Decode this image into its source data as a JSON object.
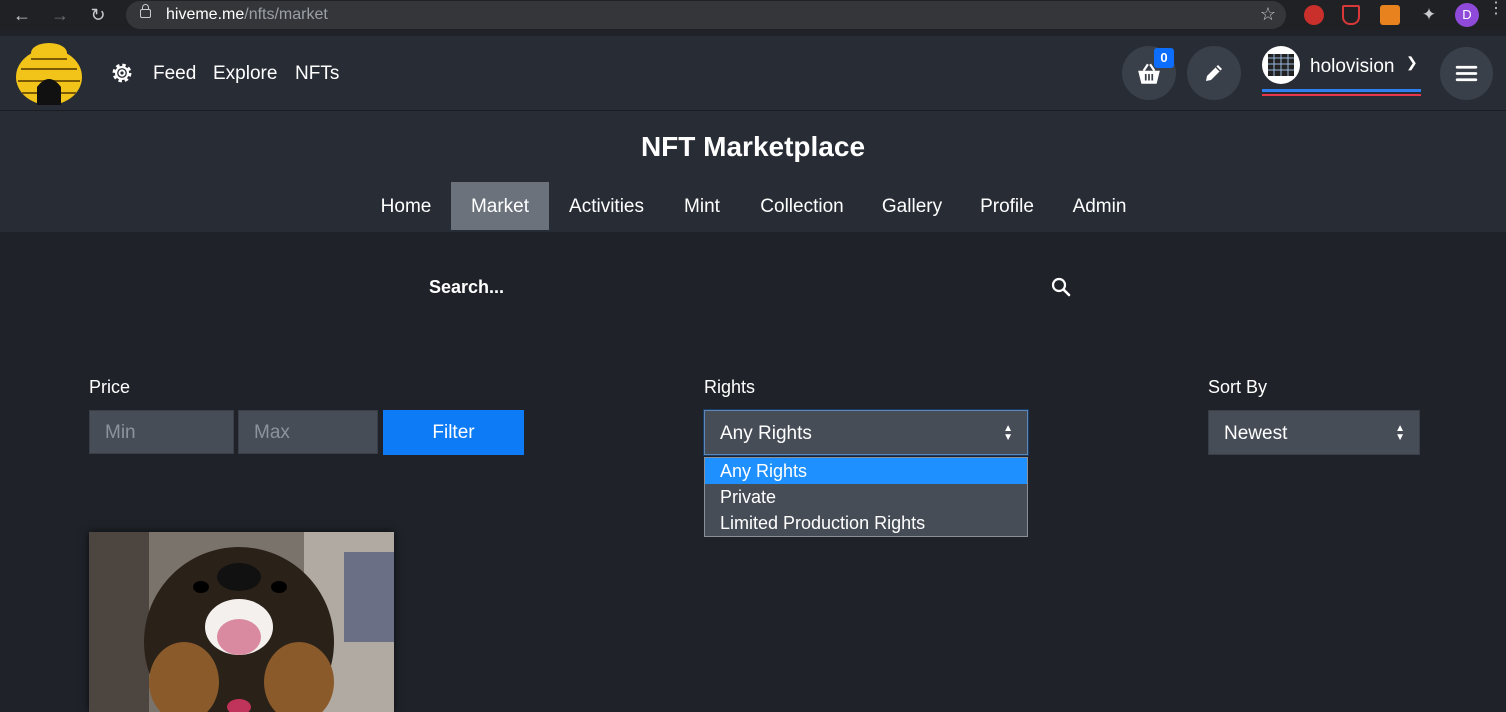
{
  "browser": {
    "url_host": "hiveme.me",
    "url_path": "/nfts/market",
    "profile_initial": "D",
    "icons": [
      "back-arrow-icon",
      "forward-arrow-icon",
      "reload-icon",
      "lock-icon",
      "star-icon",
      "extensions-icon",
      "kebab-menu-icon"
    ]
  },
  "header": {
    "nav": [
      "Feed",
      "Explore",
      "NFTs"
    ],
    "cart_count": "0",
    "username": "holovision",
    "colors": {
      "accent": "#0d6efd",
      "header_bg": "#282d35",
      "page_bg": "#1f2329"
    }
  },
  "market": {
    "title": "NFT Marketplace",
    "tabs": [
      "Home",
      "Market",
      "Activities",
      "Mint",
      "Collection",
      "Gallery",
      "Profile",
      "Admin"
    ],
    "active_tab": "Market"
  },
  "search": {
    "placeholder": "Search..."
  },
  "filters": {
    "price_label": "Price",
    "min_placeholder": "Min",
    "max_placeholder": "Max",
    "filter_button": "Filter",
    "rights_label": "Rights",
    "rights_value": "Any Rights",
    "rights_options": [
      "Any Rights",
      "Private",
      "Limited Production Rights"
    ],
    "sort_label": "Sort By",
    "sort_value": "Newest"
  }
}
